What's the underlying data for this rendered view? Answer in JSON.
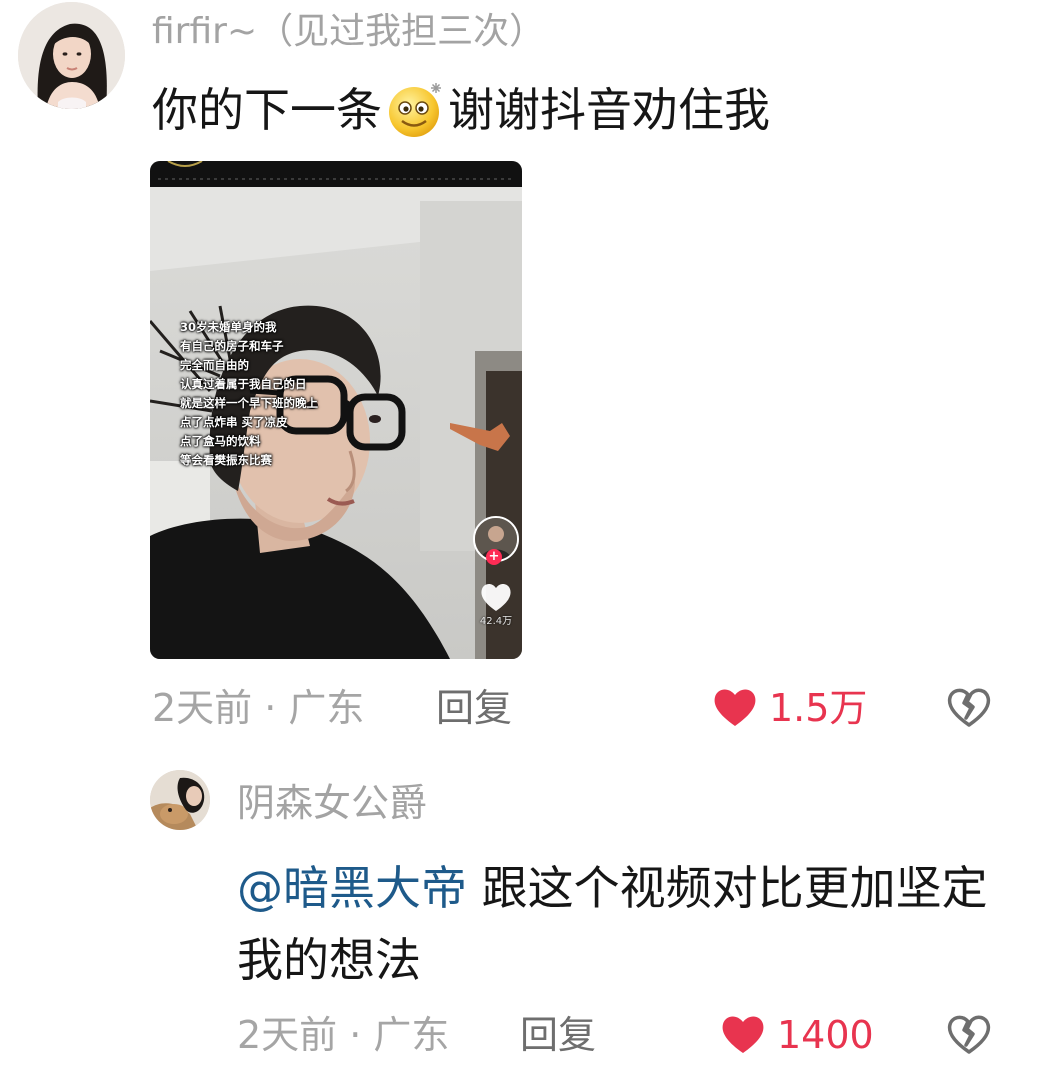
{
  "comment1": {
    "username": "firfir~（见过我担三次）",
    "text_before_emoji": "你的下一条",
    "emoji": "dizzy-smile-emoji",
    "text_after_emoji": "谢谢抖音劝住我",
    "video": {
      "caption_lines": [
        "30岁未婚单身的我",
        "有自己的房子和车子",
        "完全而自由的",
        "认真过着属于我自己的日",
        "就是这样一个早下班的晚上",
        "点了点炸串 买了凉皮",
        "点了盒马的饮料",
        "等会看樊振东比赛"
      ],
      "like_count": "42.4万"
    },
    "meta": "2天前 · 广东",
    "reply_label": "回复",
    "like_count": "1.5万"
  },
  "comment2": {
    "username": "阴森女公爵",
    "mention": "@暗黑大帝",
    "text": " 跟这个视频对比更加坚定我的想法",
    "meta": "2天前 · 广东",
    "reply_label": "回复",
    "like_count": "1400"
  },
  "colors": {
    "like_red": "#e8344f",
    "mention_blue": "#1e5a8a",
    "meta_gray": "#a5a5a5"
  }
}
